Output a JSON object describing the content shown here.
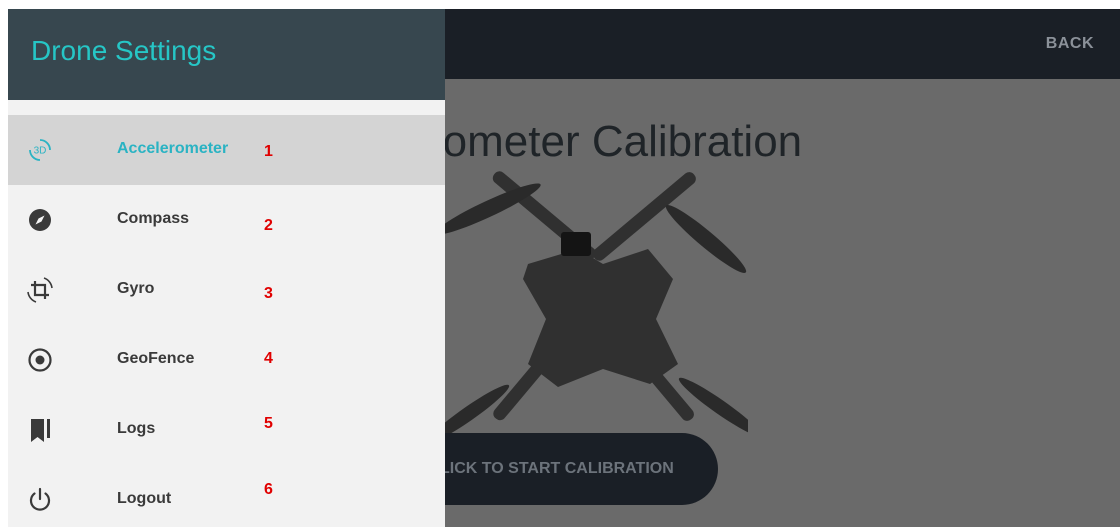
{
  "header": {
    "back_label": "BACK"
  },
  "main": {
    "heading": "rometer Calibration",
    "cta_label": "LICK TO START CALIBRATION"
  },
  "drawer": {
    "title": "Drone Settings",
    "items": [
      {
        "label": "Accelerometer",
        "number": "1",
        "icon": "accelerometer-3d-icon",
        "icon_text": "3D",
        "active": true
      },
      {
        "label": "Compass",
        "number": "2",
        "icon": "compass-icon"
      },
      {
        "label": "Gyro",
        "number": "3",
        "icon": "gyro-rotate-icon"
      },
      {
        "label": "GeoFence",
        "number": "4",
        "icon": "geofence-icon"
      },
      {
        "label": "Logs",
        "number": "5",
        "icon": "logs-icon"
      },
      {
        "label": "Logout",
        "number": "6",
        "icon": "logout-icon"
      }
    ]
  },
  "colors": {
    "accent": "#2ab3c3",
    "drawer_header": "#37474f",
    "topbar": "#1a1f26",
    "annotation": "#e00000"
  }
}
